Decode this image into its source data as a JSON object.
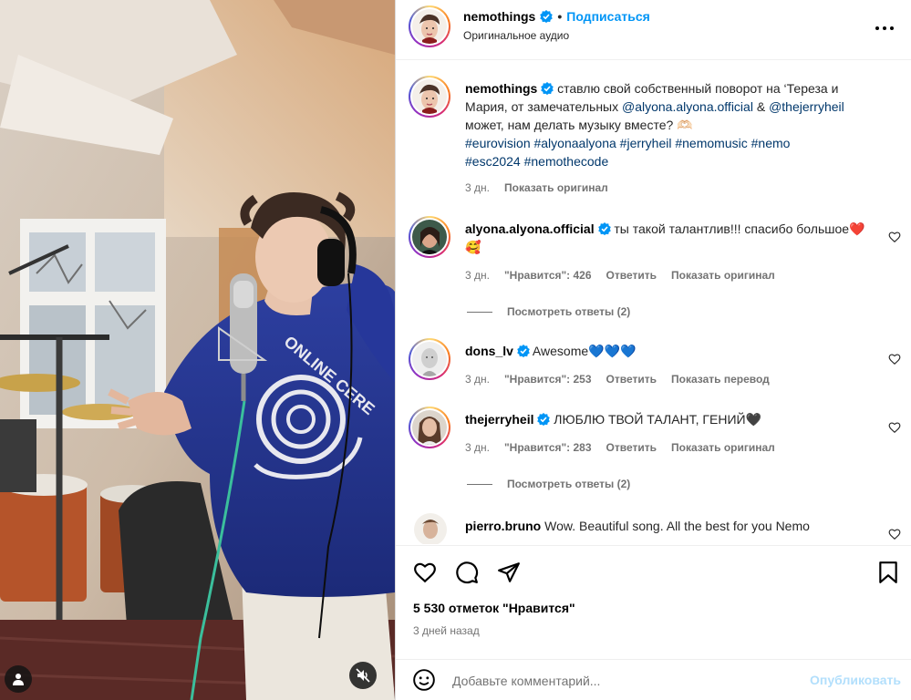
{
  "header": {
    "username": "nemothings",
    "separator": "•",
    "follow_label": "Подписаться",
    "audio_label": "Оригинальное аудио",
    "more_icon": "more-horizontal-icon"
  },
  "caption": {
    "username": "nemothings",
    "text_1": "ставлю свой собственный поворот на ‘Тереза и Мария, от замечательных",
    "mention_1": "@alyona.alyona.official",
    "amp": "&",
    "mention_2": "@thejerryheil",
    "text_2": "может, нам делать музыку вместе? 🫶🏻",
    "hashtags_1": "#eurovision #alyonaalyona #jerryheil #nemomusic #nemo",
    "hashtags_2": "#esc2024 #nemothecode",
    "time": "3 дн.",
    "show_original": "Показать оригинал"
  },
  "comments": [
    {
      "username": "alyona.alyona.official",
      "text": "ты такой талантлив!!! спасибо большое❤️🥰",
      "time": "3 дн.",
      "likes": "\"Нравится\": 426",
      "reply": "Ответить",
      "translate": "Показать оригинал",
      "view_replies": "Посмотреть ответы (2)"
    },
    {
      "username": "dons_lv",
      "text": "Awesome💙💙💙",
      "time": "3 дн.",
      "likes": "\"Нравится\": 253",
      "reply": "Ответить",
      "translate": "Показать перевод"
    },
    {
      "username": "thejerryheil",
      "text": "ЛЮБЛЮ ТВОЙ ТАЛАНТ, ГЕНИЙ🖤",
      "time": "3 дн.",
      "likes": "\"Нравится\": 283",
      "reply": "Ответить",
      "translate": "Показать оригинал",
      "view_replies": "Посмотреть ответы (2)"
    },
    {
      "username": "pierro.bruno",
      "text": "Wow. Beautiful song. All the best for you Nemo"
    }
  ],
  "actions": {
    "likes_count": "5 530 отметок \"Нравится\"",
    "time_ago": "3 дней назад"
  },
  "add_comment": {
    "placeholder": "Добавьте комментарий...",
    "publish_label": "Опубликовать"
  },
  "colors": {
    "accent": "#0095f6",
    "link": "#00376b",
    "muted": "#737373",
    "heart": "#ed4956"
  }
}
